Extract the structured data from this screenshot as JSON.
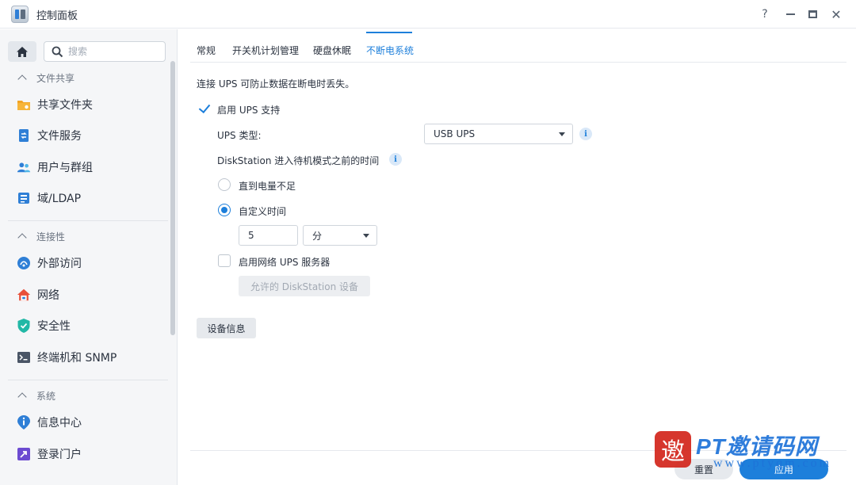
{
  "window": {
    "title": "控制面板",
    "controls": {
      "help": "?",
      "close": "✕"
    }
  },
  "sidebar": {
    "search_placeholder": "搜索",
    "groups": [
      {
        "title": "文件共享",
        "items": [
          {
            "label": "共享文件夹",
            "icon": "folder-share-icon"
          },
          {
            "label": "文件服务",
            "icon": "file-services-icon"
          },
          {
            "label": "用户与群组",
            "icon": "users-groups-icon"
          },
          {
            "label": "域/LDAP",
            "icon": "domain-ldap-icon"
          }
        ]
      },
      {
        "title": "连接性",
        "items": [
          {
            "label": "外部访问",
            "icon": "external-access-icon"
          },
          {
            "label": "网络",
            "icon": "network-house-icon"
          },
          {
            "label": "安全性",
            "icon": "shield-check-icon"
          },
          {
            "label": "终端机和 SNMP",
            "icon": "terminal-icon"
          }
        ]
      },
      {
        "title": "系统",
        "items": [
          {
            "label": "信息中心",
            "icon": "info-center-icon"
          },
          {
            "label": "登录门户",
            "icon": "login-portal-icon"
          }
        ]
      }
    ]
  },
  "tabs": [
    {
      "label": "常规",
      "active": false
    },
    {
      "label": "开关机计划管理",
      "active": false
    },
    {
      "label": "硬盘休眠",
      "active": false
    },
    {
      "label": "不断电系统",
      "active": true
    }
  ],
  "ups": {
    "description": "连接 UPS 可防止数据在断电时丢失。",
    "enable_label": "启用 UPS 支持",
    "enable_checked": true,
    "type_label": "UPS 类型:",
    "type_value": "USB UPS",
    "standby_label": "DiskStation 进入待机模式之前的时间",
    "radio_low_battery": "直到电量不足",
    "radio_custom": "自定义时间",
    "custom_selected": true,
    "time_value": "5",
    "time_unit": "分",
    "network_ups_label": "启用网络 UPS 服务器",
    "network_ups_checked": false,
    "allowed_devices_button": "允许的 DiskStation 设备",
    "device_info_button": "设备信息"
  },
  "footer": {
    "reset_label": "重置",
    "apply_label": "应用"
  },
  "watermark": {
    "seal_char": "邀",
    "text": "PT邀请码网",
    "url": "www.ptyqm.com"
  },
  "colors": {
    "accent": "#1d7fdb",
    "sidebar_bg": "#f5f6f8",
    "watermark_red": "#d3261c"
  }
}
